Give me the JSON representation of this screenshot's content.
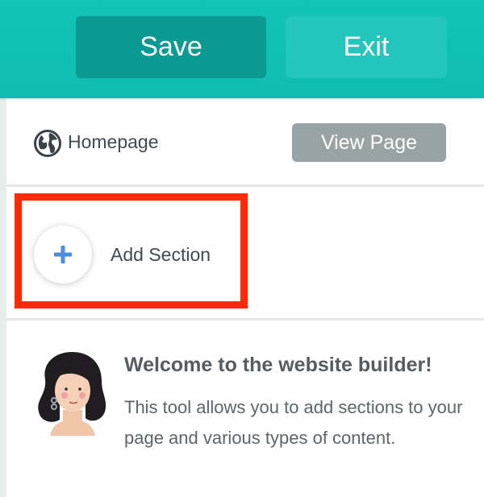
{
  "toolbar": {
    "save_label": "Save",
    "exit_label": "Exit"
  },
  "page": {
    "icon": "globe-icon",
    "name": "Homepage",
    "view_label": "View Page"
  },
  "add_section": {
    "icon": "plus-icon",
    "label": "Add Section"
  },
  "welcome": {
    "title": "Welcome to the website builder!",
    "body": "This tool allows you to add sections to your page and various types of content."
  },
  "colors": {
    "header": "#12c3b8",
    "save_button": "#0a9a92",
    "exit_button": "#22c6bd",
    "view_button": "#99a3a6",
    "highlight": "#ff2a0a",
    "plus": "#4a8ee0"
  }
}
